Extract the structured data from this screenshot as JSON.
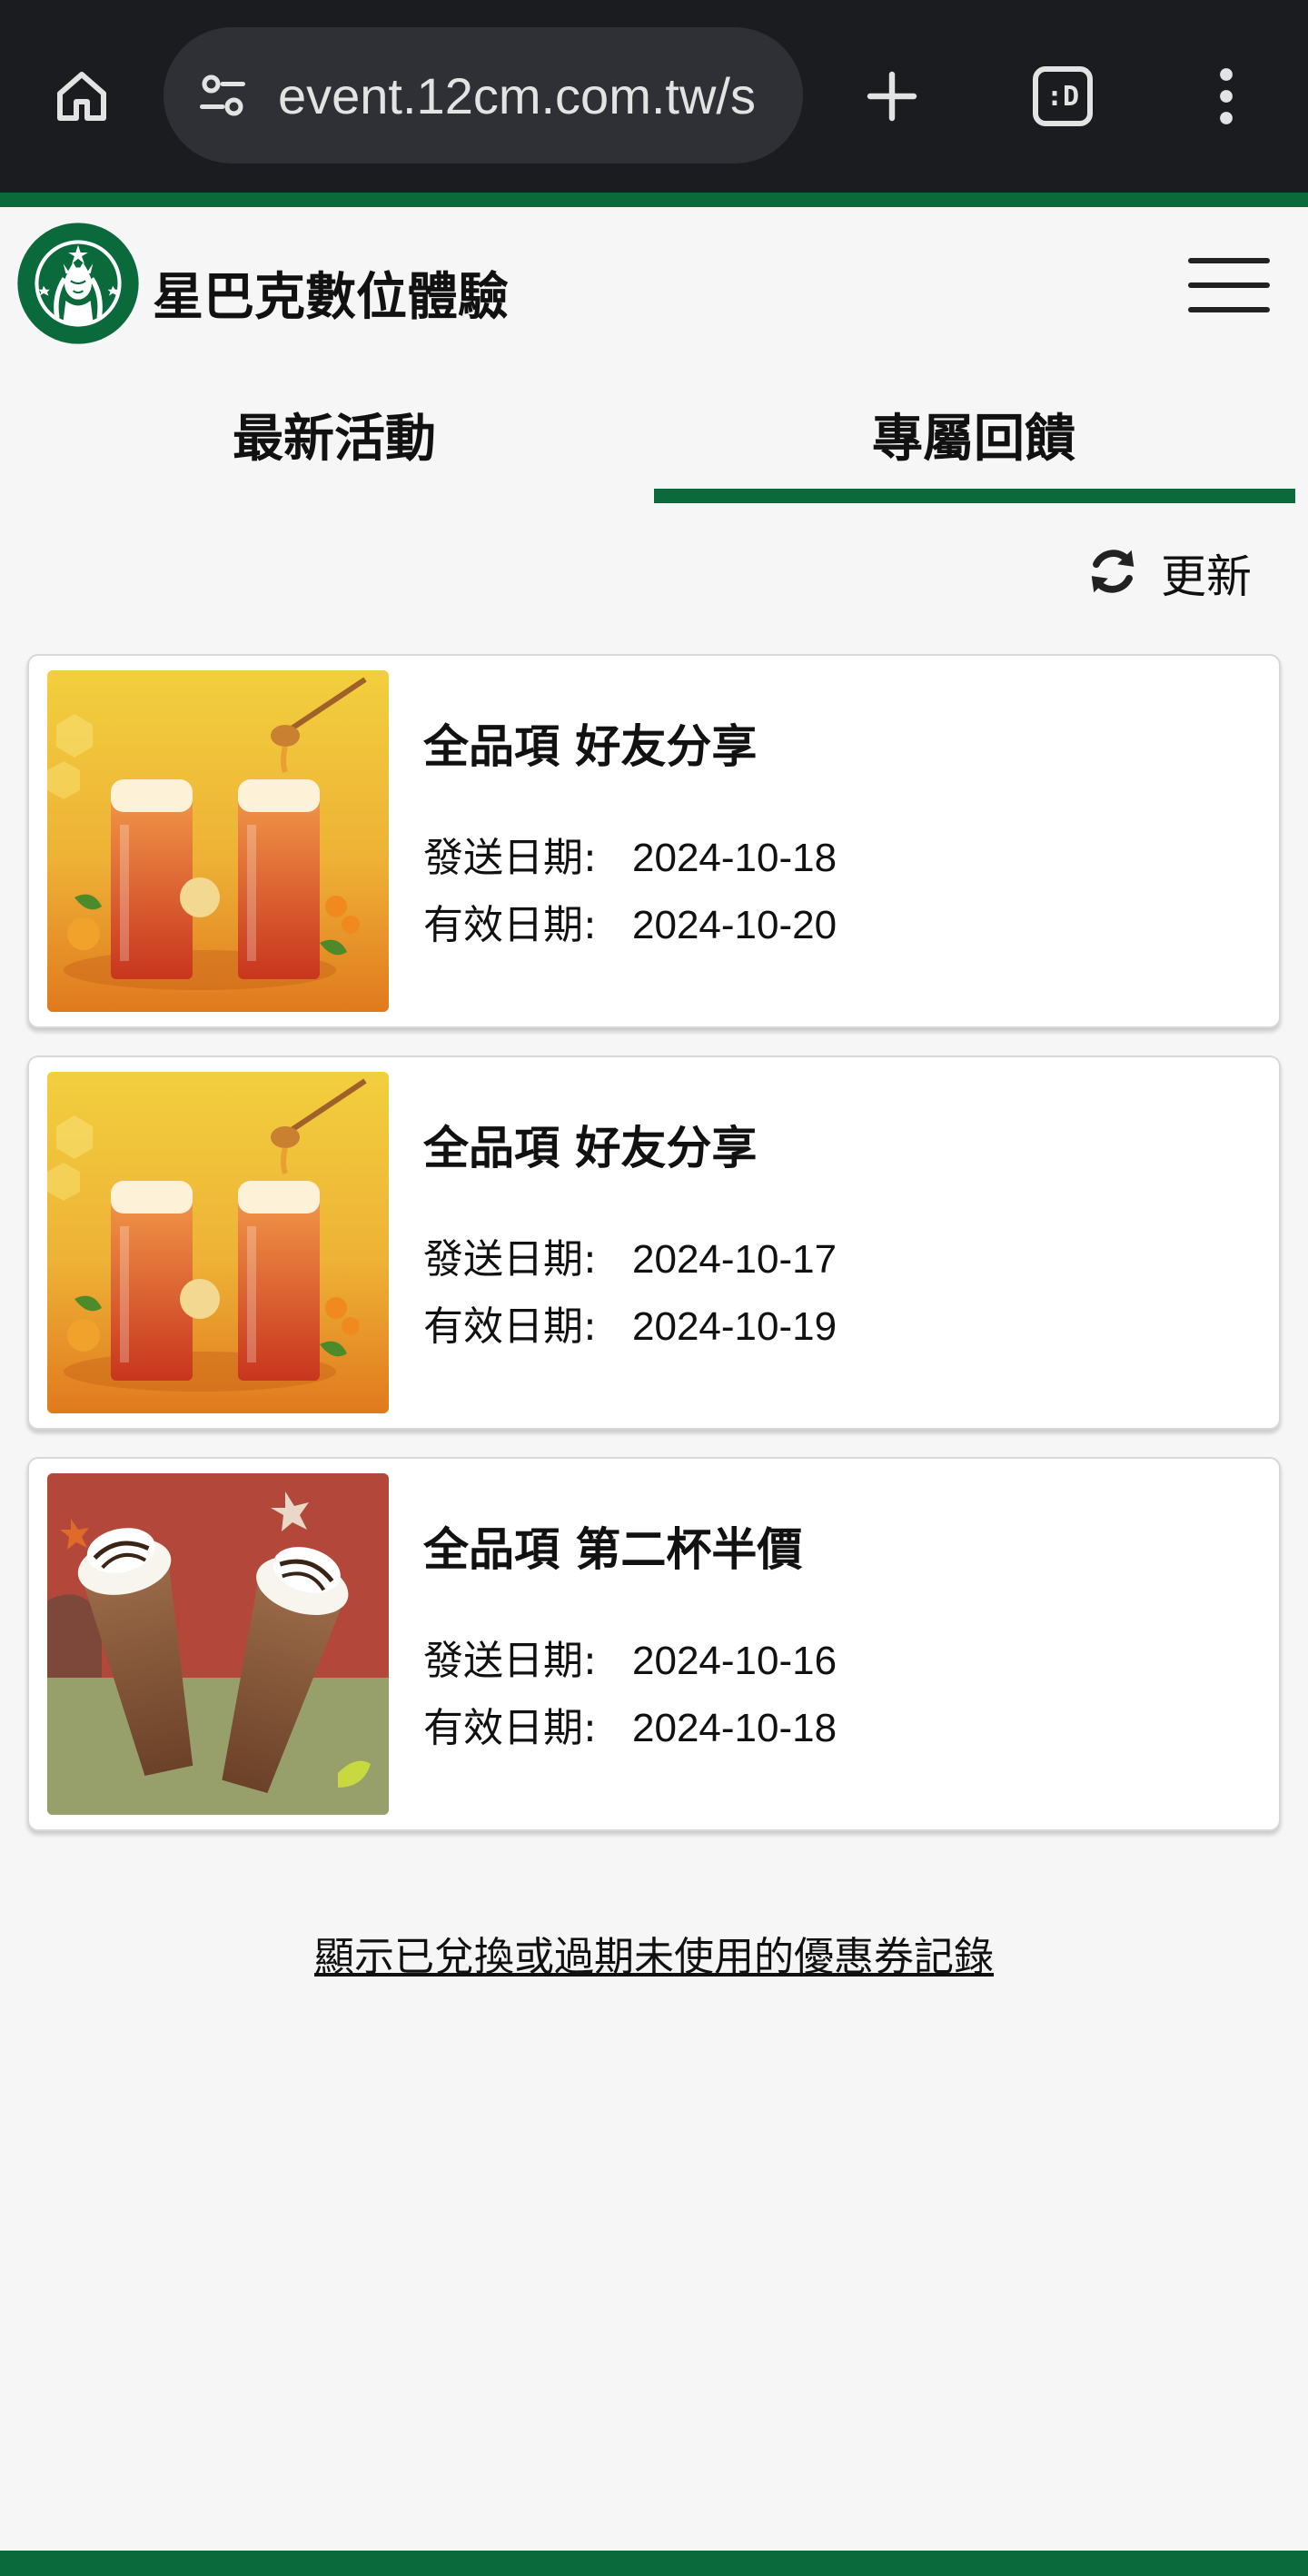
{
  "browser": {
    "url": "event.12cm.com.tw/s",
    "icons": {
      "home": "home-icon",
      "site_info": "tune-icon",
      "new_tab": "plus-icon",
      "tabs": "tab-switcher-icon",
      "menu": "more-vert-icon"
    },
    "tab_switcher_label": ":D"
  },
  "header": {
    "title": "星巴克數位體驗",
    "logo": "starbucks-siren-logo",
    "menu_icon": "hamburger-icon"
  },
  "tabs": [
    {
      "label": "最新活動",
      "active": false
    },
    {
      "label": "專屬回饋",
      "active": true
    }
  ],
  "refresh": {
    "label": "更新",
    "icon": "refresh-icon"
  },
  "labels": {
    "send_date": "發送日期:",
    "valid_date": "有效日期:"
  },
  "coupons": [
    {
      "title": "全品項 好友分享",
      "send_date": "2024-10-18",
      "valid_date": "2024-10-20",
      "image": "iced-tea-drinks"
    },
    {
      "title": "全品項 好友分享",
      "send_date": "2024-10-17",
      "valid_date": "2024-10-19",
      "image": "iced-tea-drinks"
    },
    {
      "title": "全品項 第二杯半價",
      "send_date": "2024-10-16",
      "valid_date": "2024-10-18",
      "image": "frappuccino-drinks"
    }
  ],
  "history_link": "顯示已兌換或過期未使用的優惠券記錄",
  "colors": {
    "brand_green": "#0b6a3c",
    "chrome_bg": "#1b1c1f",
    "page_bg": "#f6f6f6"
  }
}
